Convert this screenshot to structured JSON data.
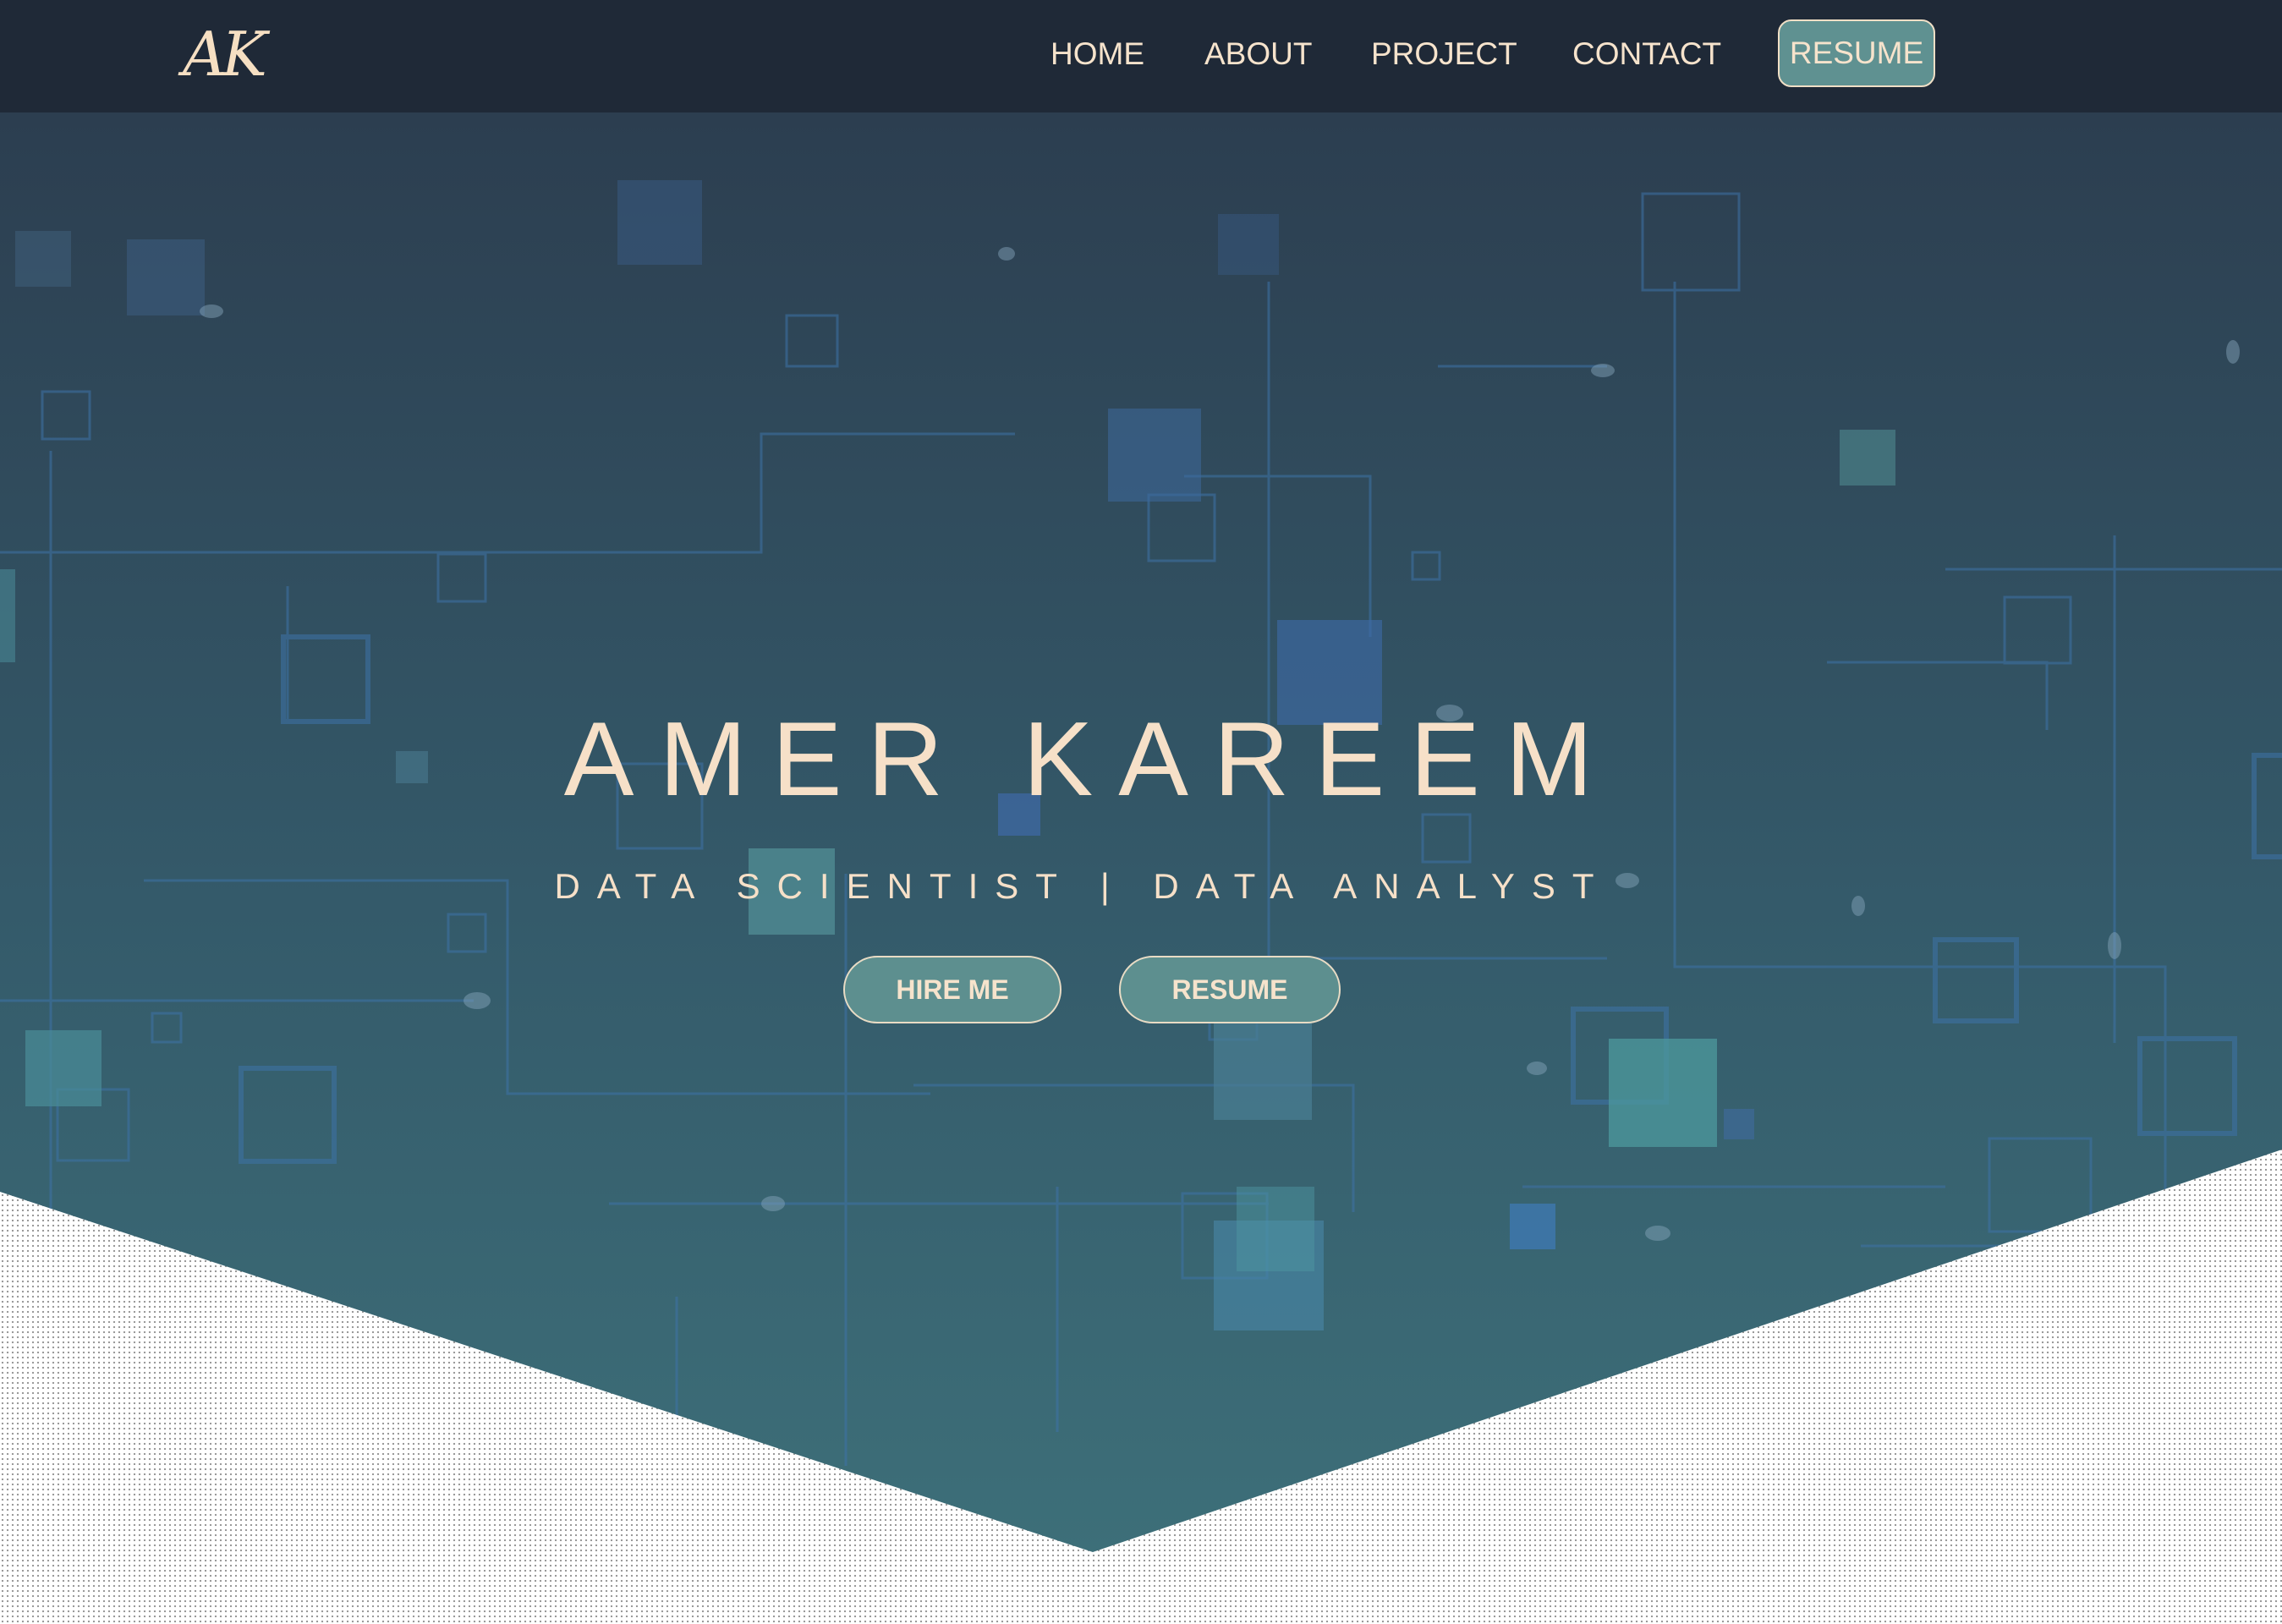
{
  "colors": {
    "navbar_bg": "#1f2937",
    "accent": "#5f9191",
    "text_cream": "#f6e0c8",
    "hero_top": "#2c3e50",
    "hero_bottom": "#3d6f79"
  },
  "navbar": {
    "logo_text": "AK",
    "links": [
      {
        "label": "HOME"
      },
      {
        "label": "ABOUT"
      },
      {
        "label": "PROJECT"
      },
      {
        "label": "CONTACT"
      }
    ],
    "resume_label": "RESUME"
  },
  "hero": {
    "name": "AMER KAREEM",
    "subtitle": "DATA SCIENTIST | DATA ANALYST",
    "hire_button": "HIRE ME",
    "resume_button": "RESUME",
    "background_pattern": "circuit-squares"
  }
}
